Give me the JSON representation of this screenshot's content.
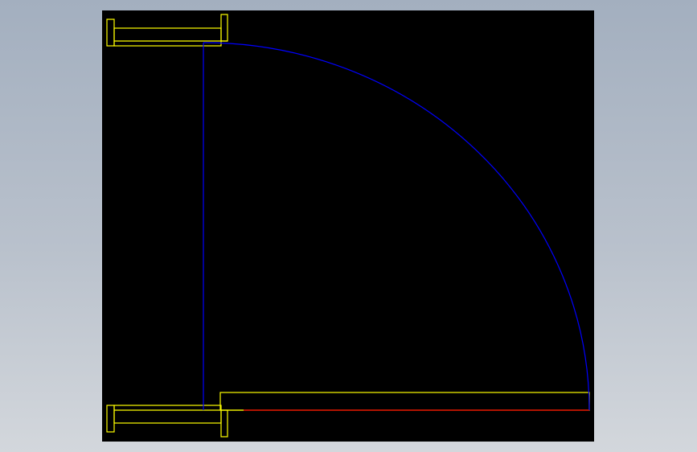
{
  "viewport": {
    "background_top": "#a3afbf",
    "background_bottom": "#d3d7dc",
    "canvas_color": "#000000"
  },
  "drawing": {
    "flange_color": "#ffff00",
    "elbow_color": "#0000ff",
    "axis_color": "#ff0000"
  }
}
